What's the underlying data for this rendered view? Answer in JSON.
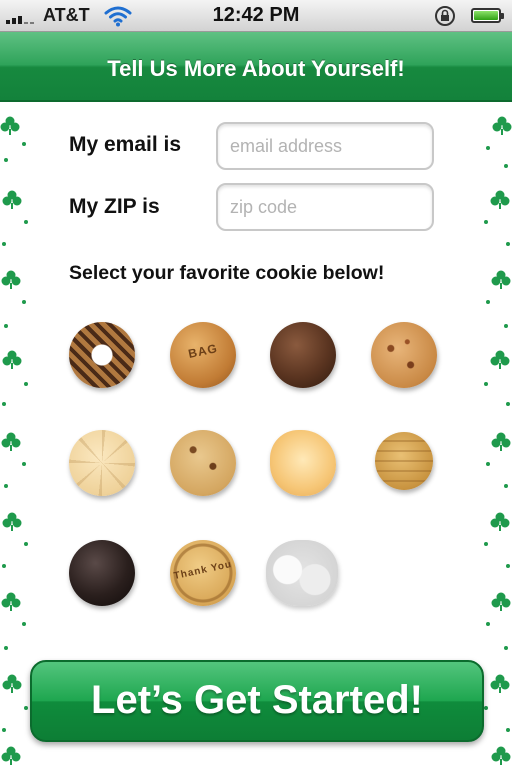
{
  "status_bar": {
    "carrier": "AT&T",
    "time": "12:42 PM",
    "icons": [
      "signal-icon",
      "wifi-icon",
      "rotation-lock-icon",
      "battery-icon"
    ]
  },
  "header": {
    "title": "Tell Us More About Yourself!"
  },
  "form": {
    "email_label": "My email is",
    "email_placeholder": "email address",
    "email_value": "",
    "zip_label": "My ZIP is",
    "zip_placeholder": "zip code",
    "zip_value": ""
  },
  "cookie_prompt": "Select your favorite cookie below!",
  "cookies": [
    "samoa-cookie",
    "tagalong-cookie",
    "thin-mint-cookie",
    "chocolate-chunk-cookie",
    "lemonade-cookie",
    "trios-cookie",
    "savannah-smiles-cookie",
    "do-si-dos-cookie",
    "fudge-cookie",
    "thank-you-cookie",
    "snowball-cookie"
  ],
  "cookie_stamps": {
    "tagalong": "BAG",
    "thank_you": "Thank You"
  },
  "start_button": {
    "label": "Let’s Get Started!"
  },
  "colors": {
    "brand_green": "#1ea64f",
    "title_bar_green": "#2fa35a",
    "clover_green": "#1f9a4c"
  }
}
